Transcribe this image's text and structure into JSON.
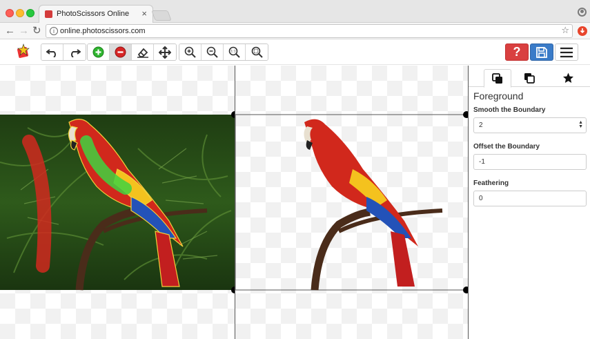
{
  "browser": {
    "tab_title": "PhotoScissors Online",
    "tab_close": "×",
    "back": "←",
    "forward": "→",
    "reload": "↻",
    "url": "online.photoscissors.com",
    "info_glyph": "i",
    "star": "☆"
  },
  "toolbar": {
    "help_label": "?",
    "icons": [
      "undo-icon",
      "redo-icon",
      "add-foreground-icon",
      "remove-background-icon",
      "eraser-icon",
      "move-icon",
      "zoom-in-icon",
      "zoom-out-icon",
      "zoom-actual-icon",
      "zoom-fit-icon"
    ],
    "active_tool": "remove-background",
    "zoom_actual_label": "1:1"
  },
  "sidebar": {
    "heading": "Foreground",
    "smooth_label": "Smooth the Boundary",
    "smooth_value": "2",
    "offset_label": "Offset the Boundary",
    "offset_value": "-1",
    "feather_label": "Feathering",
    "feather_value": "0"
  },
  "colors": {
    "help_button": "#d94040",
    "save_button": "#3a7bc8",
    "foreground_marker": "#3fd23f",
    "background_marker": "#d0291f"
  }
}
